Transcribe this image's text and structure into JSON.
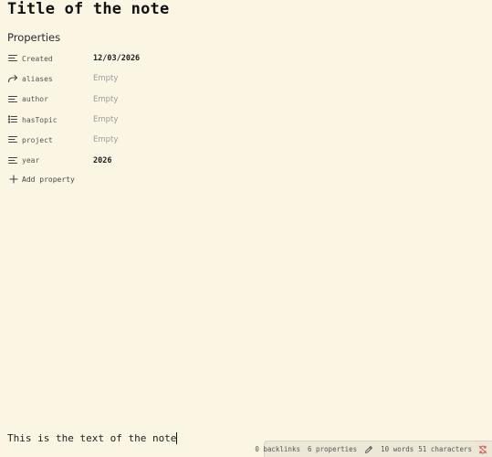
{
  "note": {
    "title": "Title of the note",
    "body": "This is the text of the note"
  },
  "properties": {
    "header": "Properties",
    "items": [
      {
        "icon": "text-lines-icon",
        "name": "Created",
        "value": "12/03/2026",
        "empty": false
      },
      {
        "icon": "arrow-forward-icon",
        "name": "aliases",
        "value": "Empty",
        "empty": true
      },
      {
        "icon": "text-lines-icon",
        "name": "author",
        "value": "Empty",
        "empty": true
      },
      {
        "icon": "list-icon",
        "name": "hasTopic",
        "value": "Empty",
        "empty": true
      },
      {
        "icon": "text-lines-icon",
        "name": "project",
        "value": "Empty",
        "empty": true
      },
      {
        "icon": "text-lines-icon",
        "name": "year",
        "value": "2026",
        "empty": false
      }
    ],
    "add_label": "Add property"
  },
  "status_bar": {
    "backlinks": "0 backlinks",
    "properties": "6 properties",
    "words": "10 words",
    "characters": "51 characters",
    "sync_color": "#d9534f"
  }
}
